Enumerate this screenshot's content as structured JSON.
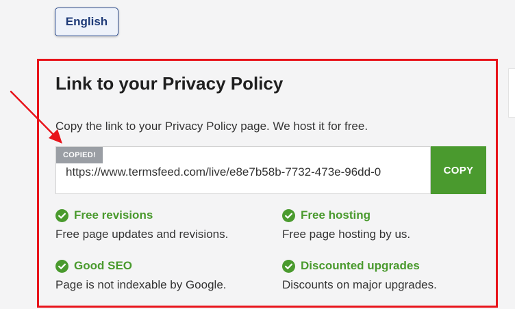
{
  "language_button": {
    "label": "English"
  },
  "card": {
    "title": "Link to your Privacy Policy",
    "description": "Copy the link to your Privacy Policy page. We host it for free.",
    "copied_badge": "COPIED!",
    "link_value": "https://www.termsfeed.com/live/e8e7b58b-7732-473e-96dd-0",
    "copy_button": "COPY"
  },
  "features": [
    {
      "title": "Free revisions",
      "desc": "Free page updates and revisions."
    },
    {
      "title": "Free hosting",
      "desc": "Free page hosting by us."
    },
    {
      "title": "Good SEO",
      "desc": "Page is not indexable by Google."
    },
    {
      "title": "Discounted upgrades",
      "desc": "Discounts on major upgrades."
    }
  ],
  "colors": {
    "accent_green": "#4a9a2e",
    "highlight_red": "#e8141b",
    "badge_gray": "#9a9ea4",
    "lang_blue": "#1e3a78"
  },
  "icons": {
    "feature_icon": "check-circle-icon",
    "annotation": "red-arrow-icon"
  }
}
